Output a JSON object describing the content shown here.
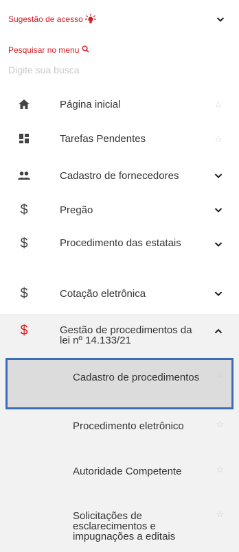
{
  "suggestion": {
    "label": "Sugestão de acesso"
  },
  "search": {
    "label": "Pesquisar no menu",
    "placeholder": "Digite sua busca",
    "value": ""
  },
  "menu": [
    {
      "label": "Página inicial",
      "icon": "home-icon",
      "right": "star"
    },
    {
      "label": "Tarefas Pendentes",
      "icon": "dashboard-icon",
      "right": "star"
    },
    {
      "label": "Cadastro de fornecedores",
      "icon": "people-icon",
      "right": "chevron-down"
    },
    {
      "label": "Pregão",
      "icon": "dollar-icon",
      "right": "chevron-down"
    },
    {
      "label": "Procedimento das estatais",
      "icon": "dollar-icon",
      "right": "chevron-down"
    },
    {
      "label": "Cotação eletrônica",
      "icon": "dollar-icon",
      "right": "chevron-down"
    },
    {
      "label": "Gestão de procedimentos da lei nº 14.133/21",
      "icon": "dollar-icon",
      "right": "chevron-up",
      "active": true
    }
  ],
  "submenu": [
    {
      "label": "Cadastro de procedimentos",
      "selected": true
    },
    {
      "label": "Procedimento eletrônico"
    },
    {
      "label": "Autoridade Competente"
    },
    {
      "label": "Solicitações de esclarecimentos e impugnações a editais"
    }
  ],
  "colors": {
    "accent": "#d21e24",
    "selection_border": "#3f6db5",
    "submenu_bg": "#f2f2f2",
    "selected_bg": "#dcdcdc"
  }
}
